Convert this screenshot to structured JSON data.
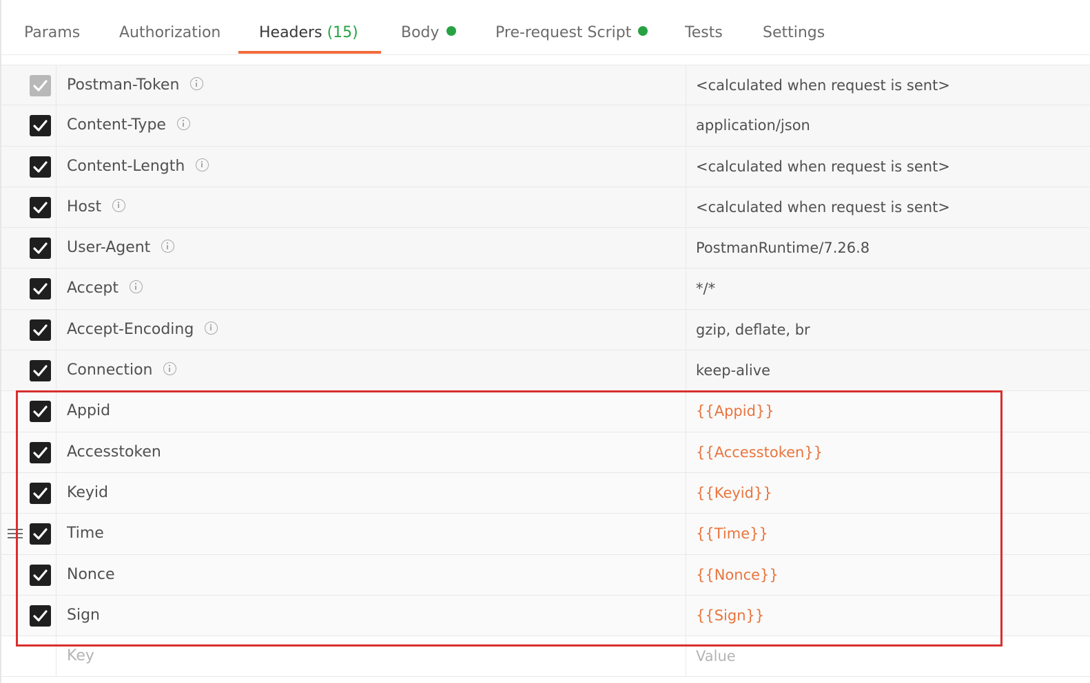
{
  "tabs": [
    {
      "label": "Params",
      "count": "",
      "dot": false
    },
    {
      "label": "Authorization",
      "count": "",
      "dot": false
    },
    {
      "label": "Headers",
      "count": "(15)",
      "dot": false
    },
    {
      "label": "Body",
      "count": "",
      "dot": true
    },
    {
      "label": "Pre-request Script",
      "count": "",
      "dot": true
    },
    {
      "label": "Tests",
      "count": "",
      "dot": false
    },
    {
      "label": "Settings",
      "count": "",
      "dot": false
    }
  ],
  "active_tab": "Headers",
  "colors": {
    "active_underline": "#f26b3a",
    "count_green": "#27a243",
    "variable_orange": "#e9743d",
    "highlight_red": "#d92e2e"
  },
  "headers": [
    {
      "key": "Postman-Token",
      "value": "<calculated when request is sent>",
      "checked": true,
      "disabled": true,
      "info": true,
      "variable": false
    },
    {
      "key": "Content-Type",
      "value": "application/json",
      "checked": true,
      "disabled": false,
      "info": true,
      "variable": false
    },
    {
      "key": "Content-Length",
      "value": "<calculated when request is sent>",
      "checked": true,
      "disabled": false,
      "info": true,
      "variable": false
    },
    {
      "key": "Host",
      "value": "<calculated when request is sent>",
      "checked": true,
      "disabled": false,
      "info": true,
      "variable": false
    },
    {
      "key": "User-Agent",
      "value": "PostmanRuntime/7.26.8",
      "checked": true,
      "disabled": false,
      "info": true,
      "variable": false
    },
    {
      "key": "Accept",
      "value": "*/*",
      "checked": true,
      "disabled": false,
      "info": true,
      "variable": false
    },
    {
      "key": "Accept-Encoding",
      "value": "gzip, deflate, br",
      "checked": true,
      "disabled": false,
      "info": true,
      "variable": false
    },
    {
      "key": "Connection",
      "value": "keep-alive",
      "checked": true,
      "disabled": false,
      "info": true,
      "variable": false
    },
    {
      "key": "Appid",
      "value": "{{Appid}}",
      "checked": true,
      "disabled": false,
      "info": false,
      "variable": true
    },
    {
      "key": "Accesstoken",
      "value": "{{Accesstoken}}",
      "checked": true,
      "disabled": false,
      "info": false,
      "variable": true
    },
    {
      "key": "Keyid",
      "value": "{{Keyid}}",
      "checked": true,
      "disabled": false,
      "info": false,
      "variable": true
    },
    {
      "key": "Time",
      "value": "{{Time}}",
      "checked": true,
      "disabled": false,
      "info": false,
      "variable": true,
      "drag_handle": true
    },
    {
      "key": "Nonce",
      "value": "{{Nonce}}",
      "checked": true,
      "disabled": false,
      "info": false,
      "variable": true
    },
    {
      "key": "Sign",
      "value": "{{Sign}}",
      "checked": true,
      "disabled": false,
      "info": false,
      "variable": true
    }
  ],
  "new_row": {
    "key_placeholder": "Key",
    "value_placeholder": "Value"
  }
}
